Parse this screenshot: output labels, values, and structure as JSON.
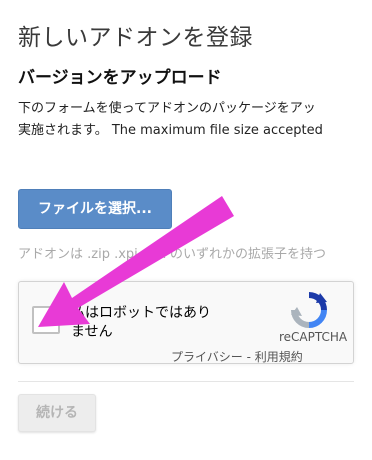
{
  "page": {
    "title": "新しいアドオンを登録"
  },
  "upload": {
    "heading": "バージョンをアップロード",
    "description_line1": "下のフォームを使ってアドオンのパッケージをアッ",
    "description_line2": "実施されます。 The maximum file size accepted",
    "file_button_label": "ファイルを選択...",
    "extension_hint": "アドオンは .zip .xpi .crx のいずれかの拡張子を持つ"
  },
  "recaptcha": {
    "label_line1": "私はロボットではあり",
    "label_line2": "ません",
    "brand": "reCAPTCHA",
    "privacy_link": "プライバシー",
    "separator": " - ",
    "terms_link": "利用規約",
    "checked": false
  },
  "form": {
    "continue_label": "続ける",
    "continue_disabled": true
  },
  "annotation": {
    "arrow_color": "#e83ad6"
  }
}
